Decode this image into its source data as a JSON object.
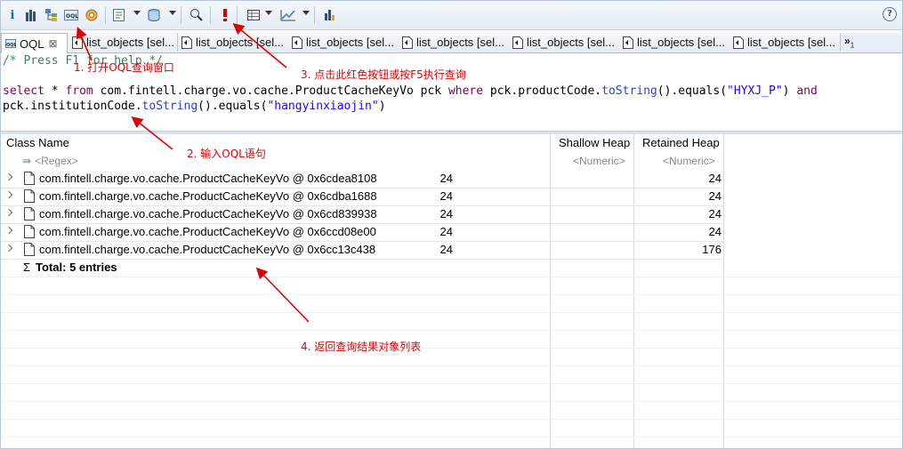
{
  "toolbar": {
    "icons": [
      "info-icon",
      "histogram-icon",
      "dominator-tree-icon",
      "oql-icon",
      "heap-dump-overview-icon",
      "query-browser-icon",
      "open-heap-dump-icon",
      "find-object-icon",
      "execute-query-icon",
      "export-icon",
      "chart-icon",
      "calculate-retained-icon",
      "help-icon"
    ],
    "help_label": "?"
  },
  "tabs": [
    {
      "label": "OQL",
      "active": true
    },
    {
      "label": "list_objects [sel..."
    },
    {
      "label": "list_objects [sel..."
    },
    {
      "label": "list_objects [sel..."
    },
    {
      "label": "list_objects [sel..."
    },
    {
      "label": "list_objects [sel..."
    },
    {
      "label": "list_objects [sel..."
    },
    {
      "label": "list_objects [sel..."
    }
  ],
  "tabs_overflow": {
    "label": "»",
    "count": "1"
  },
  "editor": {
    "comment": "/* Press F1 for help */",
    "q": {
      "select": "select",
      "star": " * ",
      "from": "from",
      "cls": " com.fintell.charge.vo.cache.ProductCacheKeyVo pck ",
      "where": "where",
      "pc": " pck.productCode.",
      "tostring1": "toString",
      "p1": "().",
      "equals1": "equals",
      "p2": "(",
      "lit1": "\"HYXJ_P\"",
      "p3": ") ",
      "and": "and",
      "ic": "pck.institutionCode.",
      "tostring2": "toString",
      "p4": "().",
      "equals2": "equals",
      "p5": "(",
      "lit2": "\"hangyinxiaojin\"",
      "p6": ")"
    }
  },
  "table": {
    "columns": {
      "class_name": "Class Name",
      "shallow": "Shallow Heap",
      "retained": "Retained Heap"
    },
    "filters": {
      "class_name": "<Regex>",
      "shallow": "<Numeric>",
      "retained": "<Numeric>"
    },
    "rows": [
      {
        "name": "com.fintell.charge.vo.cache.ProductCacheKeyVo @ 0x6cdea8108",
        "shallow": "24",
        "retained": "24"
      },
      {
        "name": "com.fintell.charge.vo.cache.ProductCacheKeyVo @ 0x6cdba1688",
        "shallow": "24",
        "retained": "24"
      },
      {
        "name": "com.fintell.charge.vo.cache.ProductCacheKeyVo @ 0x6cd839938",
        "shallow": "24",
        "retained": "24"
      },
      {
        "name": "com.fintell.charge.vo.cache.ProductCacheKeyVo @ 0x6ccd08e00",
        "shallow": "24",
        "retained": "24"
      },
      {
        "name": "com.fintell.charge.vo.cache.ProductCacheKeyVo @ 0x6cc13c438",
        "shallow": "24",
        "retained": "176"
      }
    ],
    "total": {
      "symbol": "Σ",
      "label": "Total: 5 entries"
    }
  },
  "annotations": {
    "a1": "1. 打开OQL查询窗口",
    "a2": "2. 输入OQL语句",
    "a3": "3. 点击此红色按钮或按F5执行查询",
    "a4": "4. 返回查询结果对象列表"
  },
  "colors": {
    "annotation": "#e00000",
    "keyword": "#7f0055",
    "comment": "#3f7f5f",
    "string": "#2a00ff",
    "method": "#2a3fd4"
  }
}
